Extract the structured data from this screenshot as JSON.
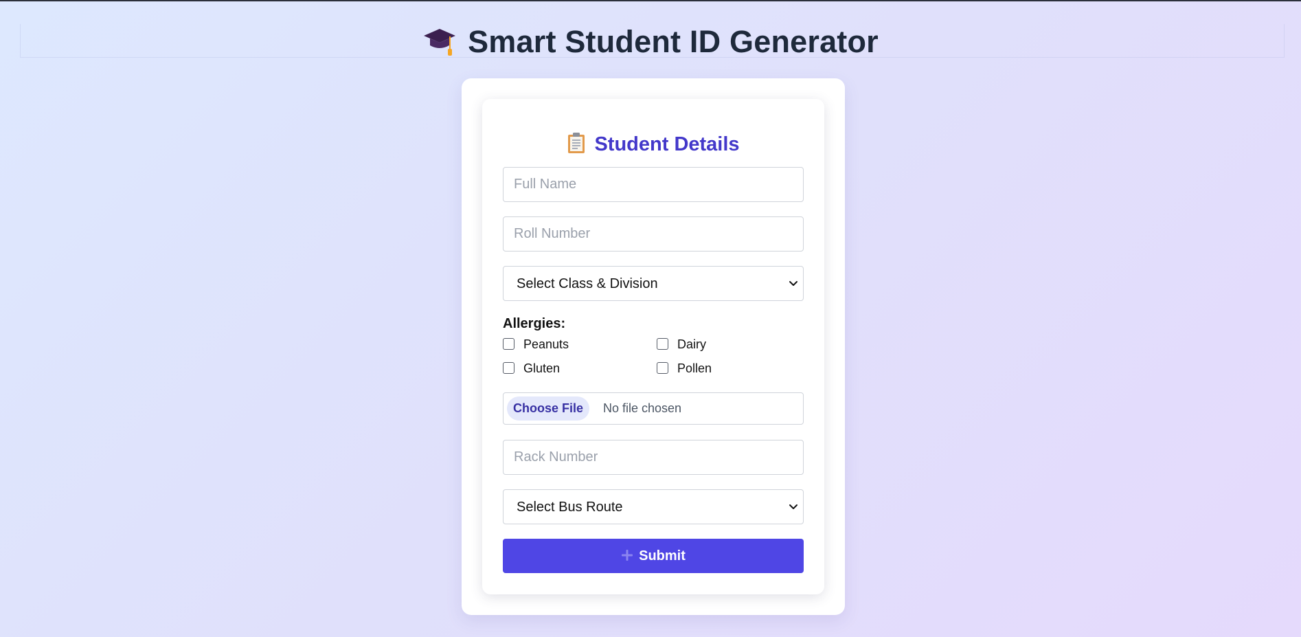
{
  "header": {
    "title": "Smart Student ID Generator",
    "icon": "graduation-cap-icon"
  },
  "form": {
    "title": "Student Details",
    "title_icon": "clipboard-icon",
    "full_name_placeholder": "Full Name",
    "roll_number_placeholder": "Roll Number",
    "class_select_value": "Select Class & Division",
    "allergies_label": "Allergies:",
    "allergies": [
      "Peanuts",
      "Dairy",
      "Gluten",
      "Pollen"
    ],
    "allergies_checked": [
      false,
      false,
      false,
      false
    ],
    "file_button_label": "Choose File",
    "file_status": "No file chosen",
    "rack_number_placeholder": "Rack Number",
    "bus_route_select_value": "Select Bus Route",
    "submit_label": "Submit",
    "submit_icon": "plus-icon"
  },
  "colors": {
    "accent": "#4f46e5",
    "title_text": "#1e293b",
    "section_title": "#4338ca"
  }
}
